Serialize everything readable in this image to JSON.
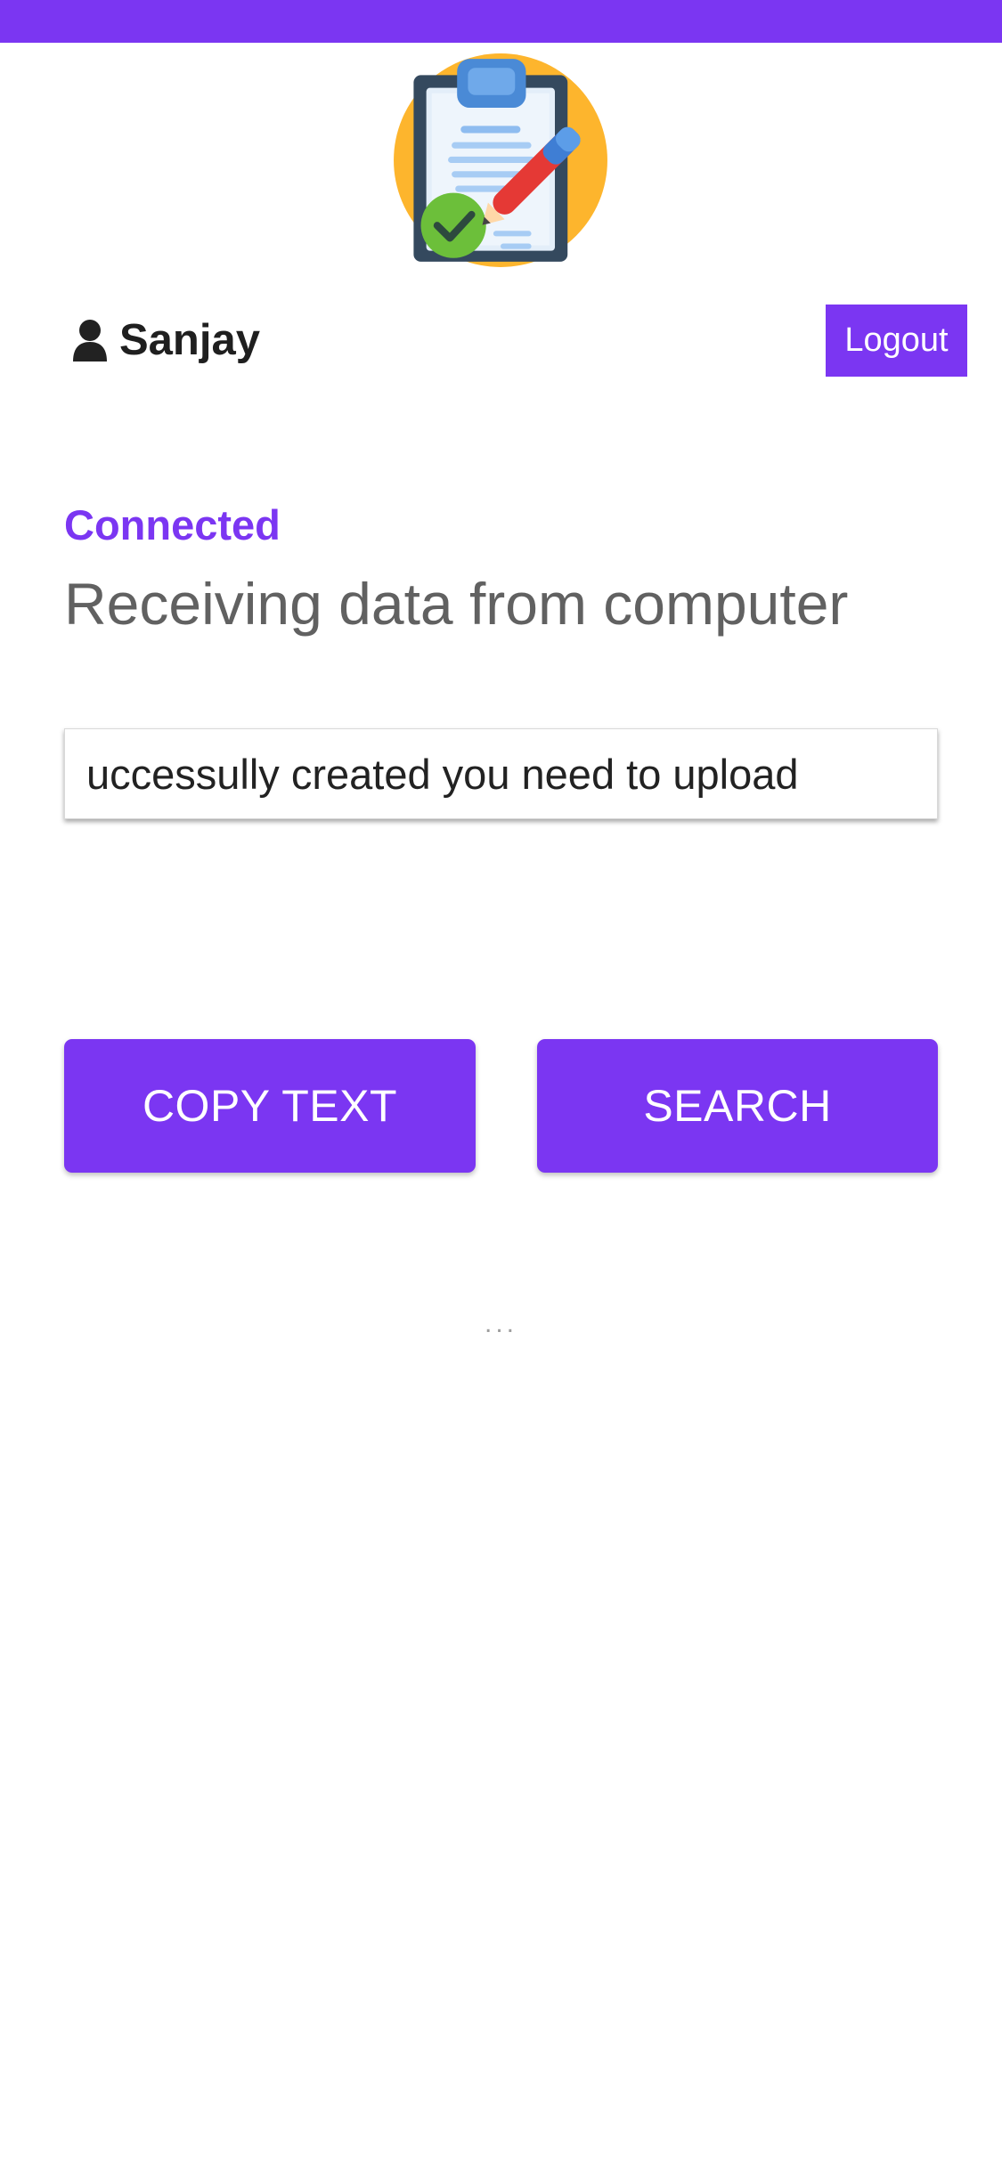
{
  "colors": {
    "accent": "#7b36f2",
    "heading": "#616161",
    "text": "#1f1f1f"
  },
  "header": {
    "logo_icon": "clipboard-checklist-pen-icon"
  },
  "user": {
    "icon": "user-icon",
    "name": "Sanjay",
    "logout_label": "Logout"
  },
  "connection": {
    "status": "Connected",
    "heading": "Receiving data from computer"
  },
  "input": {
    "value": "uccessully created you need to upload"
  },
  "actions": {
    "copy_label": "COPY TEXT",
    "search_label": "SEARCH"
  },
  "loader": {
    "text": "..."
  }
}
